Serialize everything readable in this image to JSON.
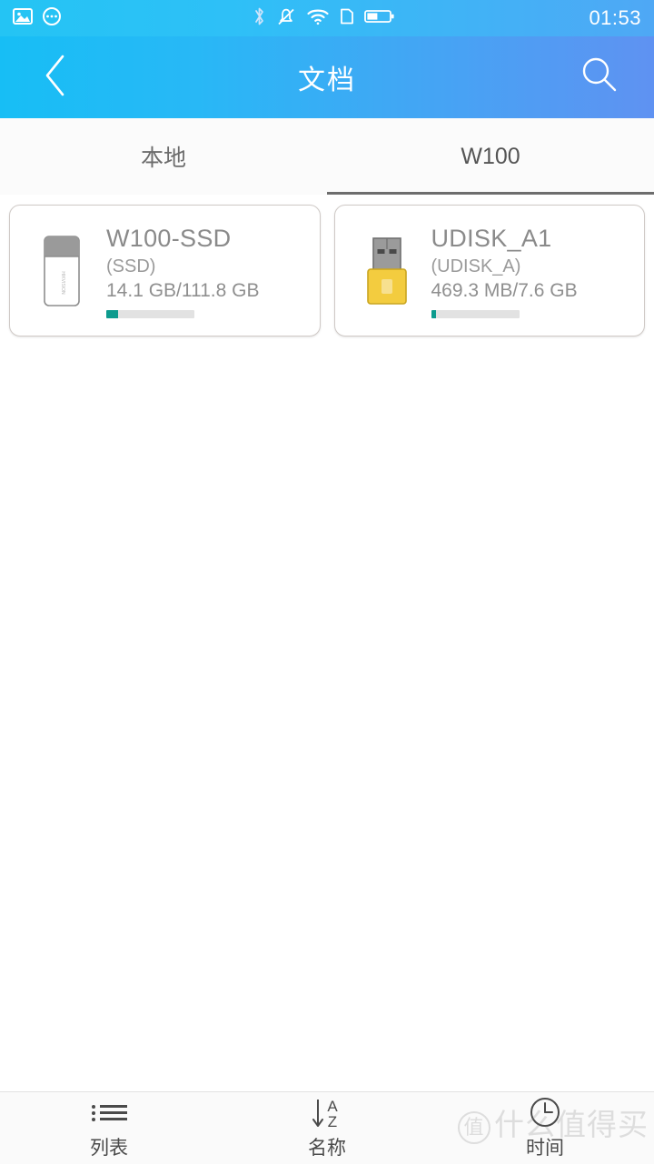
{
  "status_bar": {
    "time": "01:53",
    "left_icons": [
      "image-icon",
      "more-circle-icon"
    ],
    "right_icons": [
      "bluetooth-icon",
      "mute-bell-icon",
      "wifi-icon",
      "sim-card-icon",
      "battery-icon"
    ]
  },
  "header": {
    "title": "文档",
    "back_icon": "chevron-left-icon",
    "search_icon": "search-icon",
    "gradient_start": "#17bef5",
    "gradient_end": "#5f92f2"
  },
  "tabs": [
    {
      "label": "本地",
      "active": false
    },
    {
      "label": "W100",
      "active": true
    }
  ],
  "drives": [
    {
      "name": "W100-SSD",
      "label": "(SSD)",
      "usage": "14.1 GB/111.8 GB",
      "used_percent": 13,
      "icon": "ssd-drive-icon",
      "bar_color": "#0d9b8e"
    },
    {
      "name": "UDISK_A1",
      "label": "(UDISK_A)",
      "usage": "469.3 MB/7.6 GB",
      "used_percent": 6,
      "icon": "usb-flash-drive-icon",
      "bar_color": "#0d9b8e"
    }
  ],
  "bottom_bar": [
    {
      "label": "列表",
      "icon": "list-icon"
    },
    {
      "label": "名称",
      "icon": "sort-az-icon"
    },
    {
      "label": "时间",
      "icon": "clock-icon"
    }
  ],
  "watermark": {
    "badge": "值",
    "text": "什么值得买"
  }
}
